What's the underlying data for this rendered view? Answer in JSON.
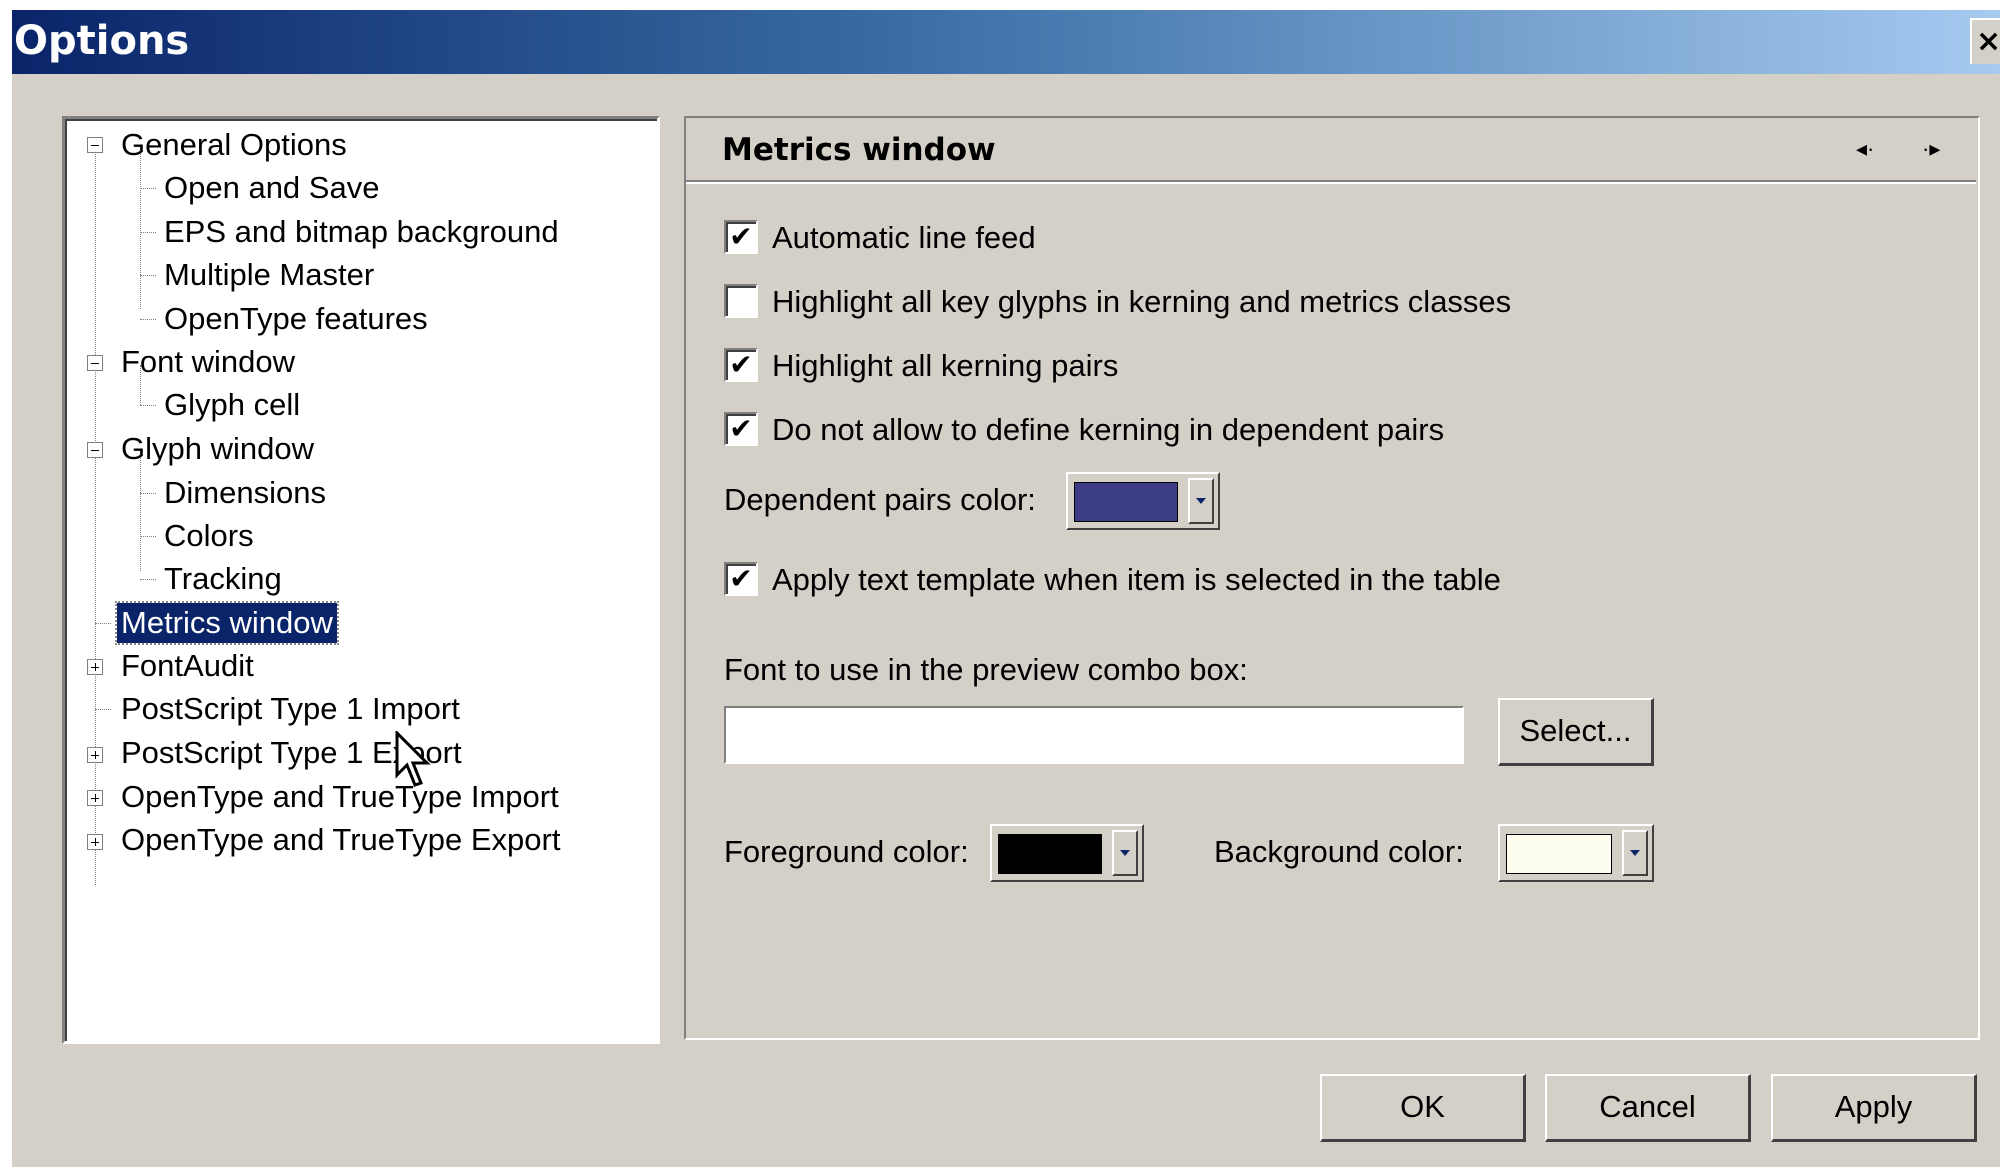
{
  "window": {
    "title": "Options",
    "close_glyph": "×"
  },
  "tree": {
    "items": [
      {
        "label": "General Options",
        "expander": "minus"
      },
      {
        "label": "Open and Save"
      },
      {
        "label": "EPS and bitmap background"
      },
      {
        "label": "Multiple Master"
      },
      {
        "label": "OpenType features"
      },
      {
        "label": "Font window",
        "expander": "minus"
      },
      {
        "label": "Glyph cell"
      },
      {
        "label": "Glyph window",
        "expander": "minus"
      },
      {
        "label": "Dimensions"
      },
      {
        "label": "Colors"
      },
      {
        "label": "Tracking"
      },
      {
        "label": "Metrics window",
        "selected": true
      },
      {
        "label": "FontAudit",
        "expander": "plus"
      },
      {
        "label": "PostScript Type 1 Import"
      },
      {
        "label": "PostScript Type 1 Export",
        "expander": "plus"
      },
      {
        "label": "OpenType and TrueType Import",
        "expander": "plus"
      },
      {
        "label": "OpenType and TrueType Export",
        "expander": "plus"
      }
    ]
  },
  "panel": {
    "title": "Metrics window",
    "prev_icon": "◂·",
    "next_icon": "·▸",
    "options": [
      {
        "label": "Automatic line feed",
        "checked": true,
        "mark": "✔"
      },
      {
        "label": "Highlight all key glyphs in kerning and metrics classes",
        "checked": false,
        "mark": ""
      },
      {
        "label": "Highlight all kerning pairs",
        "checked": true,
        "mark": "✔"
      },
      {
        "label": "Do not allow to define kerning in dependent pairs",
        "checked": true,
        "mark": "✔"
      },
      {
        "label": "Apply text template when item is selected in the table",
        "checked": true,
        "mark": "✔"
      }
    ],
    "dependent_color_label": "Dependent pairs color:",
    "dependent_color": "#3b3b86",
    "preview_font_label": "Font to use in the preview combo box:",
    "preview_font_value": "",
    "select_button": "Select...",
    "foreground_label": "Foreground color:",
    "foreground_color": "#000000",
    "background_label": "Background color:",
    "background_color": "#fefef0"
  },
  "buttons": {
    "ok": "OK",
    "cancel": "Cancel",
    "apply": "Apply"
  }
}
